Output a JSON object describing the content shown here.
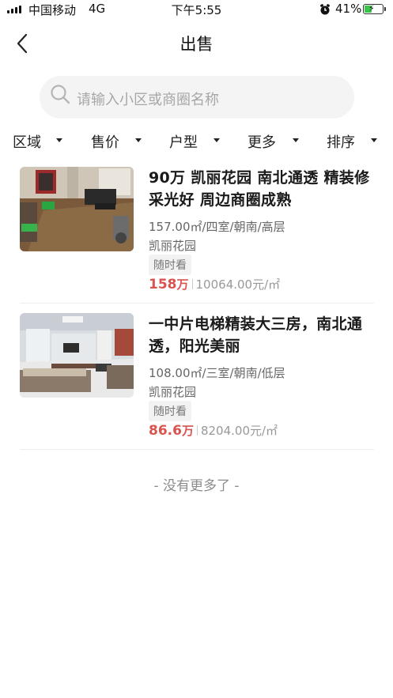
{
  "status_bar": {
    "carrier": "中国移动",
    "network": "4G",
    "time": "下午5:55",
    "battery": "41%",
    "battery_level": 0.41,
    "icons": [
      "signal-icon",
      "alarm-icon",
      "battery-icon"
    ]
  },
  "nav": {
    "title": "出售",
    "back_icon": "chevron-left-icon"
  },
  "search": {
    "placeholder": "请输入小区或商圈名称",
    "icon": "search-icon"
  },
  "filters": [
    {
      "label": "区域"
    },
    {
      "label": "售价"
    },
    {
      "label": "户型"
    },
    {
      "label": "更多"
    },
    {
      "label": "排序"
    }
  ],
  "listings": [
    {
      "title": "90万 凯丽花园 南北通透 精装修 采光好 周边商圈成熟",
      "spec": "157.00㎡/四室/朝南/高层",
      "community": "凯丽花园",
      "tag": "随时看",
      "price": "158",
      "price_unit": "万",
      "unit_price": "10064.00元/㎡"
    },
    {
      "title": "一中片电梯精装大三房，南北通透，阳光美丽",
      "spec": "108.00㎡/三室/朝南/低层",
      "community": "凯丽花园",
      "tag": "随时看",
      "price": "86.6",
      "price_unit": "万",
      "unit_price": "8204.00元/㎡"
    }
  ],
  "footer": {
    "no_more": "- 没有更多了 -"
  },
  "colors": {
    "price": "#d9534f",
    "accent_green": "#3ac44a",
    "search_bg": "#f4f4f4"
  }
}
